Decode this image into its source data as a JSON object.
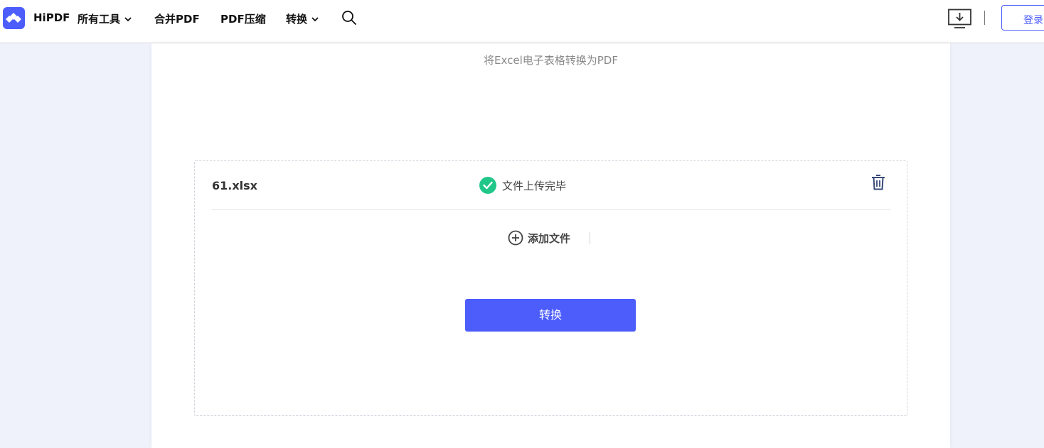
{
  "header": {
    "brand": "HiPDF",
    "nav": [
      {
        "label": "所有工具",
        "has_dropdown": true
      },
      {
        "label": "合并PDF",
        "has_dropdown": false
      },
      {
        "label": "PDF压缩",
        "has_dropdown": false
      },
      {
        "label": "转换",
        "has_dropdown": true
      }
    ],
    "search_icon": "search-icon",
    "download_icon": "desktop-download-icon",
    "login_label": "登录"
  },
  "main": {
    "subtitle": "将Excel电子表格转换为PDF",
    "file": {
      "name": "61.xlsx",
      "status": "文件上传完毕",
      "status_icon": "check-circle-icon",
      "delete_icon": "trash-icon"
    },
    "add_file_label": "添加文件",
    "convert_label": "转换"
  },
  "colors": {
    "accent": "#4c5dfc",
    "success": "#21c789",
    "page_bg": "#eff1fb"
  }
}
